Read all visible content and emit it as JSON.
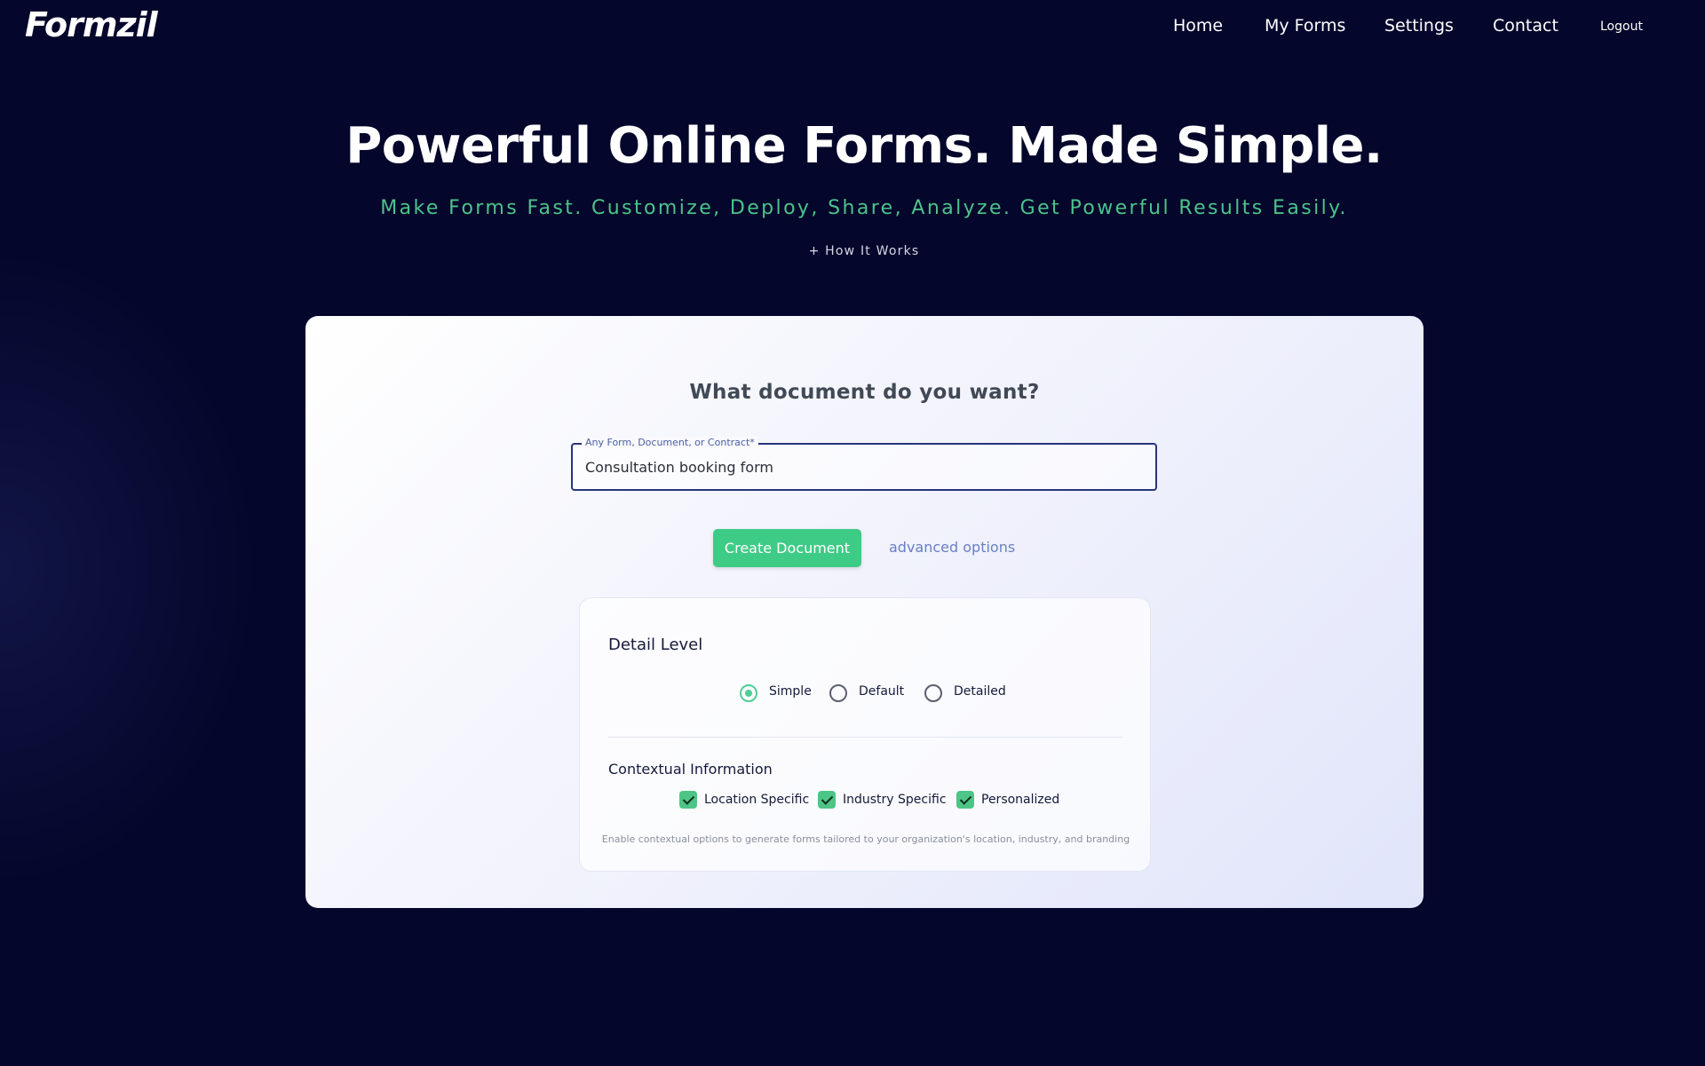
{
  "nav": {
    "logo": "Formzil",
    "links": [
      "Home",
      "My Forms",
      "Settings",
      "Contact"
    ],
    "logout": "Logout"
  },
  "hero": {
    "title": "Powerful Online Forms. Made Simple.",
    "subtitle": "Make Forms Fast. Customize, Deploy, Share, Analyze. Get Powerful Results Easily.",
    "how_it_works": "+ How It Works"
  },
  "form": {
    "title": "What document do you want?",
    "input_label": "Any Form, Document, or Contract*",
    "input_value": "Consultation booking form",
    "create_button": "Create Document",
    "advanced_link": "advanced options"
  },
  "options": {
    "detail_level": {
      "title": "Detail Level",
      "choices": [
        "Simple",
        "Default",
        "Detailed"
      ],
      "selected": "Simple"
    },
    "contextual": {
      "title": "Contextual Information",
      "items": [
        {
          "label": "Location Specific",
          "checked": true
        },
        {
          "label": "Industry Specific",
          "checked": true
        },
        {
          "label": "Personalized",
          "checked": true
        }
      ],
      "help_text": "Enable contextual options to generate forms tailored to your organization's location, industry, and branding"
    }
  },
  "colors": {
    "background": "#05062b",
    "accent_green": "#3ecb86",
    "link_blue": "#6a7fc4",
    "input_border": "#27357a"
  },
  "icons": [
    "radio-checked-icon",
    "radio-unchecked-icon",
    "checkbox-checked-icon"
  ]
}
